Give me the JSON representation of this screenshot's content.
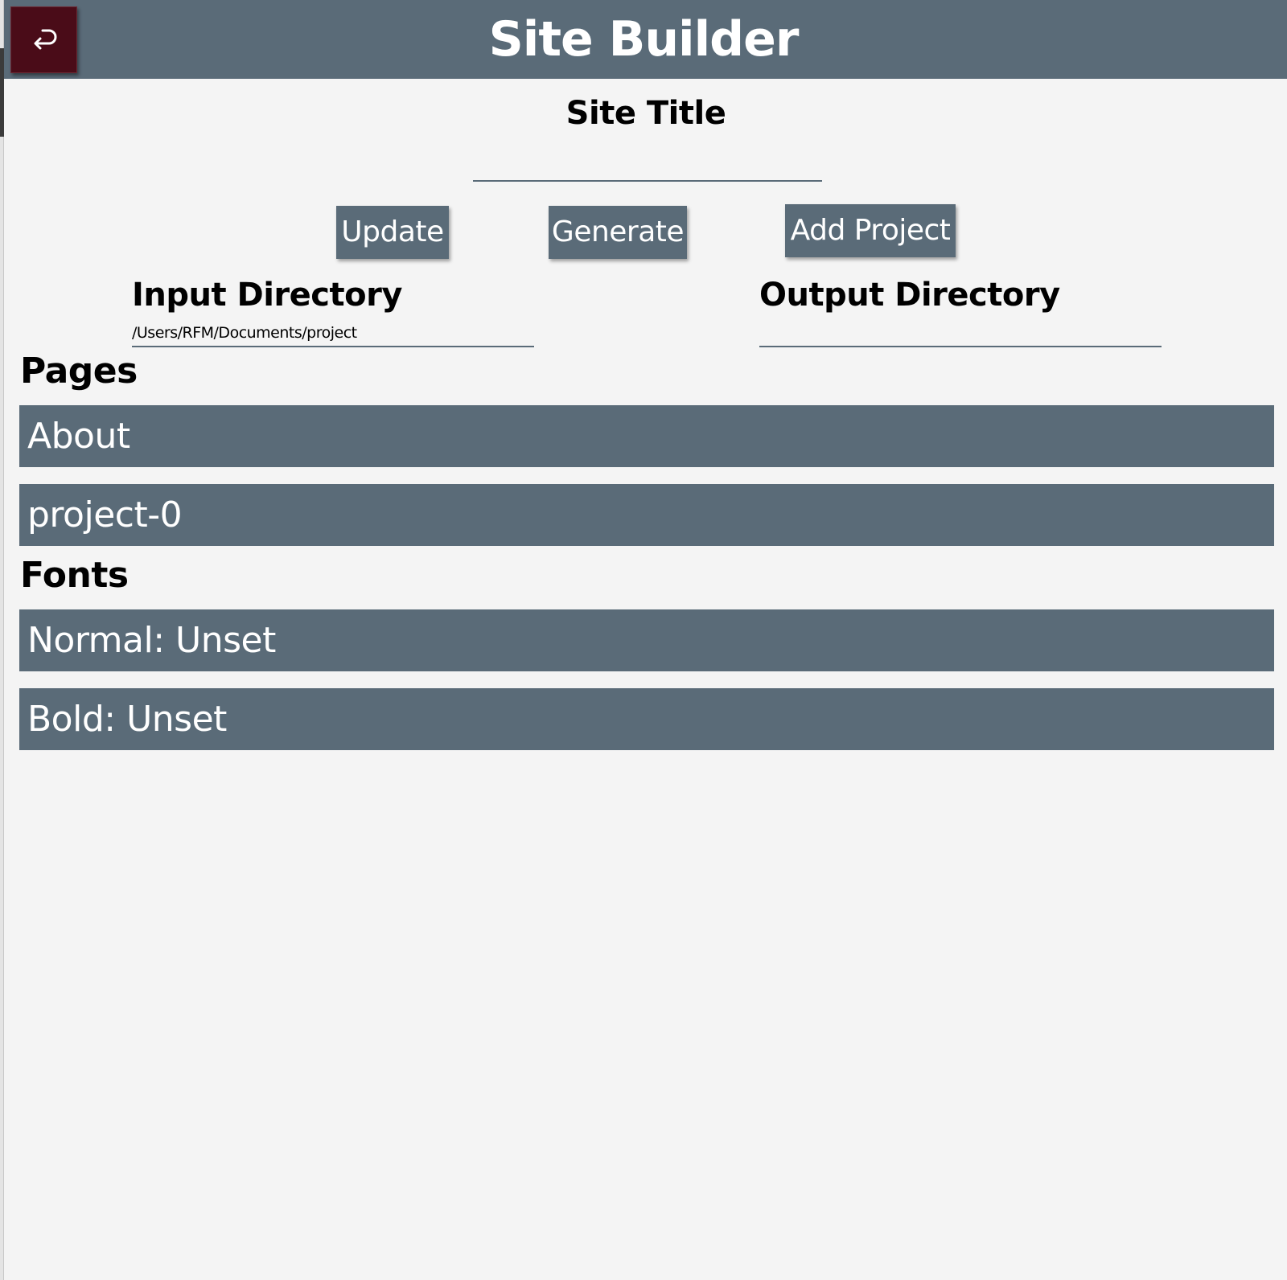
{
  "header": {
    "title": "Site Builder",
    "back_icon": "return-arrow-icon"
  },
  "site_title": {
    "label": "Site Title",
    "value": ""
  },
  "toolbar": {
    "update_label": "Update",
    "generate_label": "Generate",
    "add_project_label": "Add Project"
  },
  "directories": {
    "input_label": "Input Directory",
    "input_value": "/Users/RFM/Documents/project",
    "output_label": "Output Directory",
    "output_value": ""
  },
  "pages": {
    "heading": "Pages",
    "items": [
      {
        "label": "About"
      },
      {
        "label": "project-0"
      }
    ]
  },
  "fonts": {
    "heading": "Fonts",
    "items": [
      {
        "label": "Normal: Unset"
      },
      {
        "label": "Bold: Unset"
      }
    ]
  },
  "colors": {
    "header_bg": "#5a6b78",
    "back_button_bg": "#4a0c18",
    "page_bg": "#f4f4f4",
    "row_bg": "#5a6b78"
  }
}
